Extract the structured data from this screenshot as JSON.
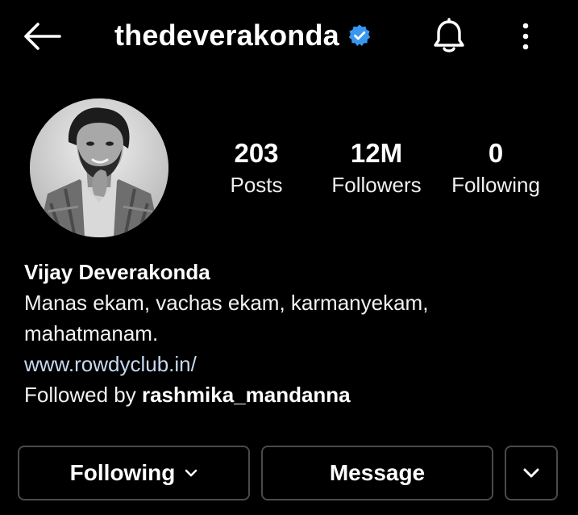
{
  "header": {
    "username": "thedeverakonda",
    "verified": true,
    "icons": {
      "back": "arrow-left-icon",
      "verified": "verified-badge-icon",
      "notifications": "bell-icon",
      "more": "more-vertical-icon"
    }
  },
  "profile": {
    "avatar": "profile-photo",
    "stats": [
      {
        "value": "203",
        "label": "Posts"
      },
      {
        "value": "12M",
        "label": "Followers"
      },
      {
        "value": "0",
        "label": "Following"
      }
    ]
  },
  "bio": {
    "name": "Vijay Deverakonda",
    "line1": "Manas ekam, vachas ekam, karmanyekam,",
    "line2": "mahatmanam.",
    "link": "www.rowdyclub.in/",
    "followed_by_prefix": "Followed by ",
    "followed_by_user": "rashmika_mandanna"
  },
  "actions": {
    "following_label": "Following",
    "message_label": "Message"
  },
  "colors": {
    "background": "#000000",
    "verified_badge": "#3897f0",
    "button_border": "#4a4a4a",
    "link": "#c7d9f0"
  }
}
